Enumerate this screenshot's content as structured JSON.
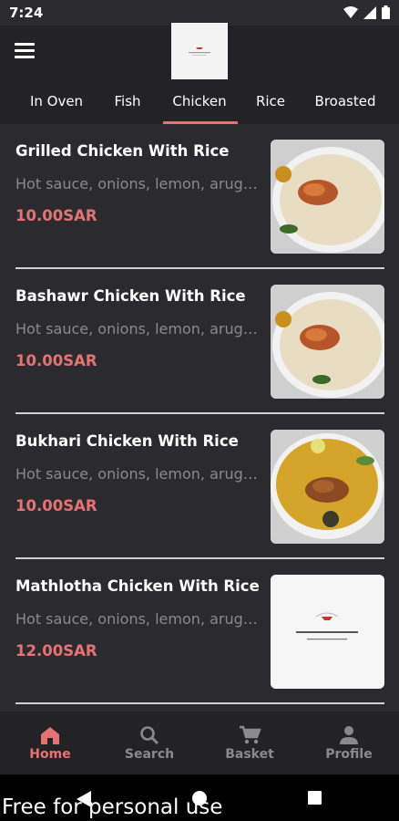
{
  "status_bar": {
    "time": "7:24"
  },
  "header": {
    "logo_alt": "restaurant-logo"
  },
  "tabs": [
    {
      "label": "In Oven"
    },
    {
      "label": "Fish"
    },
    {
      "label": "Chicken",
      "active": true
    },
    {
      "label": "Rice"
    },
    {
      "label": "Broasted"
    }
  ],
  "items": [
    {
      "name": "Grilled Chicken With Rice",
      "description": "Hot sauce, onions, lemon, arugula",
      "price": "10.00SAR"
    },
    {
      "name": "Bashawr Chicken With Rice",
      "description": "Hot sauce, onions, lemon, arugula",
      "price": "10.00SAR"
    },
    {
      "name": "Bukhari Chicken With Rice",
      "description": "Hot sauce, onions, lemon, arugula",
      "price": "10.00SAR"
    },
    {
      "name": "Mathlotha Chicken With Rice",
      "description": "Hot sauce, onions, lemon, arugula",
      "price": "12.00SAR"
    }
  ],
  "bottom_nav": [
    {
      "label": "Home",
      "icon": "home-icon",
      "active": true
    },
    {
      "label": "Search",
      "icon": "search-icon"
    },
    {
      "label": "Basket",
      "icon": "cart-icon"
    },
    {
      "label": "Profile",
      "icon": "profile-icon"
    }
  ],
  "watermark": "Free for personal use",
  "colors": {
    "accent": "#e57373",
    "background": "#2b2b2f",
    "header": "#232326"
  }
}
